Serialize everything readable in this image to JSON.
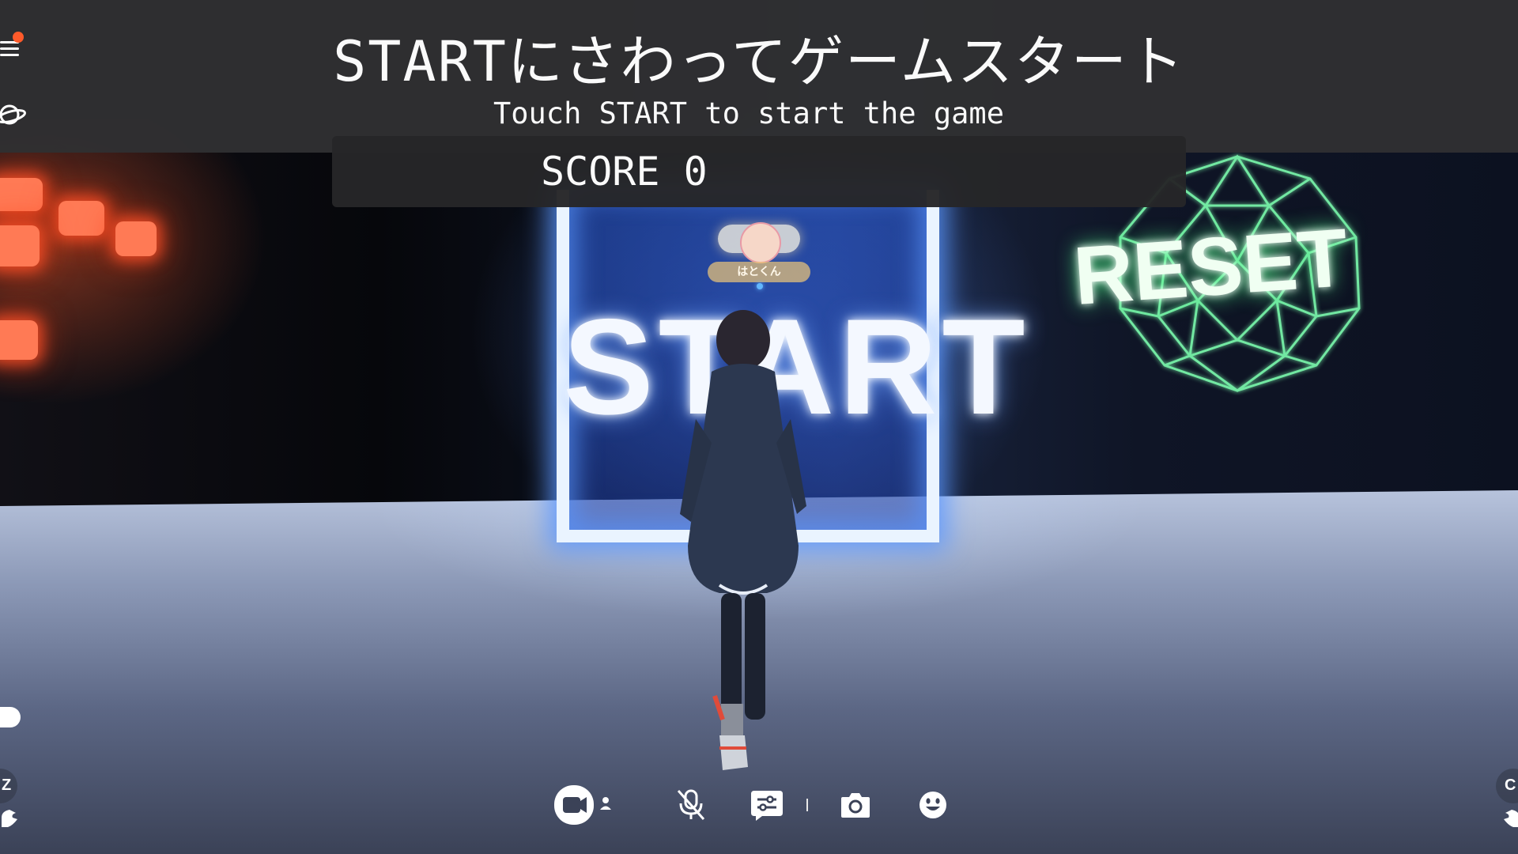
{
  "hud": {
    "instruction_ja": "STARTにさわってゲームスタート",
    "instruction_en": "Touch START to start the game",
    "score_label": "SCORE",
    "score_value": "0"
  },
  "scene": {
    "start_sign": "START",
    "reset_sign": "RESET",
    "player_name": "はとくん"
  },
  "left_rail": {
    "menu_icon": "menu-icon",
    "notification_color": "#ff5a2a",
    "world_icon": "planet-icon",
    "chat_icon": "chat-bubble-icon",
    "left_hand_key": "Z"
  },
  "right_rail": {
    "right_hand_key": "C"
  },
  "toolbar": {
    "items": [
      "camera-icon",
      "mic-off-icon",
      "settings-sliders-icon",
      "screenshot-camera-icon",
      "emote-smile-icon"
    ]
  },
  "colors": {
    "start_glow": "#5a96ff",
    "reset_glow": "#50ff8c",
    "hud_bg": "#303032",
    "red_blocks": "#ff7a55"
  }
}
